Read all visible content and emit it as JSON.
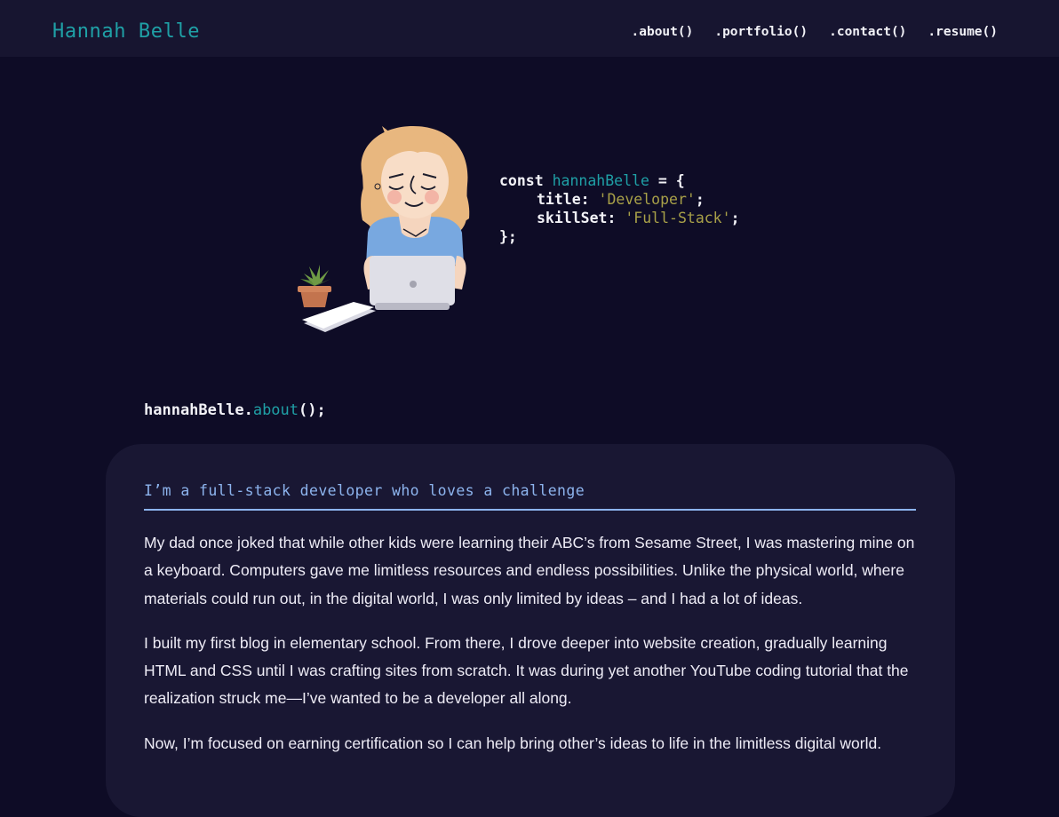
{
  "header": {
    "logo": "Hannah Belle",
    "nav": [
      ".about()",
      ".portfolio()",
      ".contact()",
      ".resume()"
    ]
  },
  "hero": {
    "illustration": "developer-girl-with-laptop",
    "code": {
      "kw": "const",
      "name": "hannahBelle",
      "open": "= {",
      "title_key": "title: ",
      "title_val": "'Developer'",
      "title_end": ";",
      "skill_key": "skillSet: ",
      "skill_val": "'Full-Stack'",
      "skill_end": ";",
      "close": "};"
    }
  },
  "about": {
    "call_obj": "hannahBelle.",
    "call_method": "about",
    "call_end": "();",
    "heading": "I’m a full-stack developer who loves a challenge",
    "paragraphs": [
      "My dad once joked that while other kids were learning their ABC’s from Sesame Street, I was mastering mine on a keyboard. Computers gave me limitless resources and endless possibilities. Unlike the physical world, where materials could run out, in the digital world, I was only limited by ideas – and I had a lot of ideas.",
      "I built my first blog in elementary school. From there, I drove deeper into website creation, gradually learning HTML and CSS until I was crafting sites from scratch. It was during yet another YouTube coding tutorial that the realization struck me—I’ve wanted to be a developer all along.",
      "Now, I’m focused on earning certification so I can help bring other’s ideas to life in the limitless digital world."
    ]
  },
  "colors": {
    "background": "#0e0c26",
    "header": "#171530",
    "card": "#191733",
    "teal": "#1fa0a6",
    "olive": "#a8a048",
    "heading_blue": "#8db4ee"
  }
}
